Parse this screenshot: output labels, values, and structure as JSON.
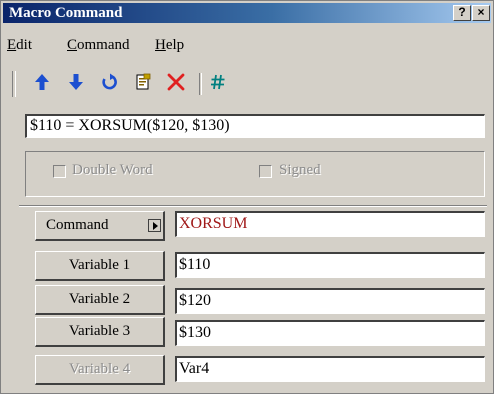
{
  "window": {
    "title": "Macro Command",
    "help_button": "?",
    "close_button": "×"
  },
  "menu": {
    "items": [
      {
        "key": "E",
        "rest": "dit"
      },
      {
        "key": "C",
        "rest": "ommand"
      },
      {
        "key": "H",
        "rest": "elp"
      }
    ]
  },
  "toolbar": {
    "icons": [
      "up-arrow-icon",
      "down-arrow-icon",
      "undo-icon",
      "document-icon",
      "delete-icon",
      "hash-icon"
    ],
    "colors": {
      "blue": "#1c4fd0",
      "red": "#e02020",
      "teal": "#008080",
      "doc": "#806000"
    }
  },
  "command_line": {
    "value": "$110 = XORSUM($120, $130)"
  },
  "options": {
    "double_word": "Double Word",
    "signed": "Signed"
  },
  "fields": {
    "command": {
      "label": "Command",
      "value": "XORSUM"
    },
    "variable1": {
      "label": "Variable 1",
      "value": "$110"
    },
    "variable2": {
      "label": "Variable 2",
      "value": "$120"
    },
    "variable3": {
      "label": "Variable 3",
      "value": "$130"
    },
    "variable4": {
      "label": "Variable 4",
      "value": "Var4"
    }
  }
}
